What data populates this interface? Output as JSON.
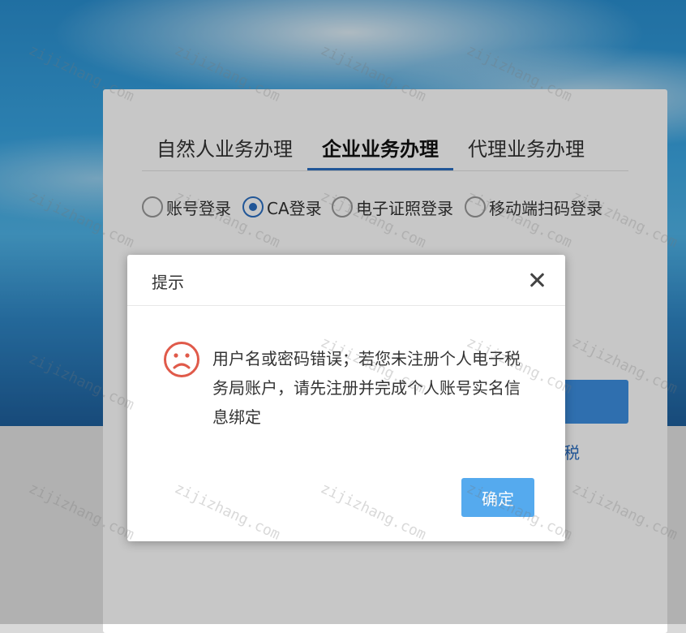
{
  "tabs": [
    {
      "label": "自然人业务办理"
    },
    {
      "label": "企业业务办理"
    },
    {
      "label": "代理业务办理"
    }
  ],
  "login_methods": [
    {
      "label": "账号登录",
      "checked": false
    },
    {
      "label": "CA登录",
      "checked": true
    },
    {
      "label": "电子证照登录",
      "checked": false
    },
    {
      "label": "移动端扫码登录",
      "checked": false
    }
  ],
  "side_link_text": "税",
  "dialog": {
    "title": "提示",
    "message": "用户名或密码错误；若您未注册个人电子税务局账户，请先注册并完成个人账号实名信息绑定",
    "ok_label": "确定"
  },
  "watermark": "zijizhang.com",
  "colors": {
    "accent": "#2b6fc2",
    "ok_button": "#55aaee",
    "error_icon": "#e05a4a"
  }
}
